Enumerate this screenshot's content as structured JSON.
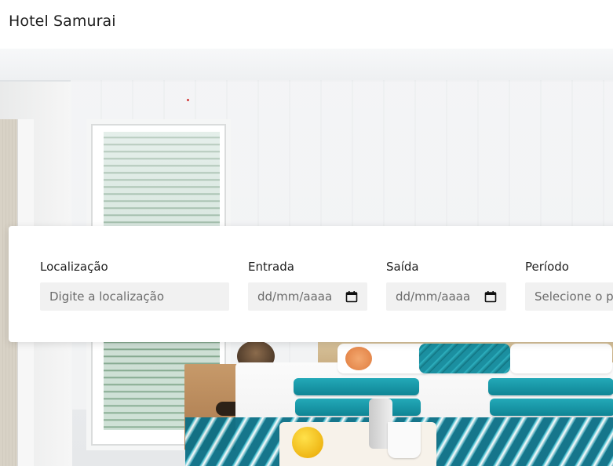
{
  "header": {
    "brand": "Hotel Samurai"
  },
  "search": {
    "location": {
      "label": "Localização",
      "placeholder": "Digite a localização"
    },
    "checkin": {
      "label": "Entrada",
      "value_display": "dd/mm/aaaa"
    },
    "checkout": {
      "label": "Saída",
      "value_display": "dd/mm/aaaa"
    },
    "period": {
      "label": "Período",
      "placeholder": "Selecione o pe"
    }
  },
  "icons": {
    "calendar": "calendar-icon"
  },
  "colors": {
    "input_bg": "#f1f1f1",
    "text": "#1f1f1f",
    "placeholder": "#6b6b6b"
  }
}
